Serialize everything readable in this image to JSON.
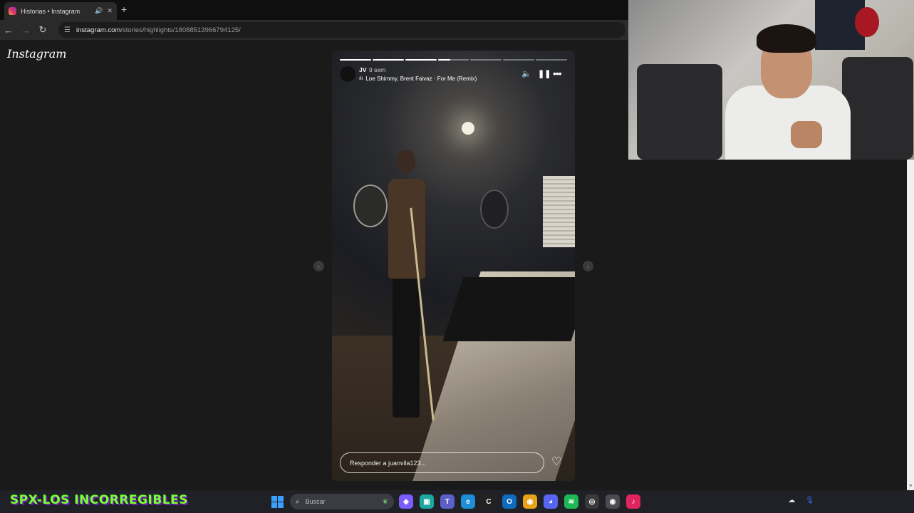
{
  "browser": {
    "tab_title": "Historias • Instagram",
    "tab_audio_icon": "speaker-icon",
    "tab_close": "✕",
    "new_tab": "+",
    "url_domain": "instagram.com",
    "url_path": "/stories/highlights/18088513966794125/"
  },
  "instagram": {
    "logo": "Instagram",
    "story": {
      "username": "JV",
      "time_ago": "9 sem",
      "music_icon": "music-bars-icon",
      "music": "Loe Shimmy, Brent Faivaz · For Me (Remix)",
      "progress": [
        1,
        1,
        1,
        0.4,
        0,
        0,
        0
      ],
      "reply_placeholder": "Responder a juanvila123...",
      "controls": [
        "volume-icon",
        "pause-icon",
        "more-icon"
      ]
    }
  },
  "overlay": {
    "banner": "SPX-LOS INCORREGIBLES"
  },
  "taskbar": {
    "search_placeholder": "Buscar",
    "apps": [
      {
        "name": "copilot-icon",
        "color": "#7a5cff",
        "glyph": "◆"
      },
      {
        "name": "store-icon",
        "color": "#1aa8a0",
        "glyph": "▣"
      },
      {
        "name": "teams-icon",
        "color": "#5b5fc7",
        "glyph": "T"
      },
      {
        "name": "edge-icon",
        "color": "#1e8fd6",
        "glyph": "e"
      },
      {
        "name": "call-of-duty-icon",
        "color": "#222222",
        "glyph": "C"
      },
      {
        "name": "outlook-icon",
        "color": "#0f6cbd",
        "glyph": "O"
      },
      {
        "name": "chrome-icon",
        "color": "#e8a317",
        "glyph": "◉"
      },
      {
        "name": "discord-icon",
        "color": "#5865f2",
        "glyph": "◕"
      },
      {
        "name": "spotify-icon",
        "color": "#1db954",
        "glyph": "≋"
      },
      {
        "name": "obs-icon",
        "color": "#3a3a3a",
        "glyph": "◎"
      },
      {
        "name": "chrome-active-icon",
        "color": "#4a4a4f",
        "glyph": "◉"
      },
      {
        "name": "tiktok-icon",
        "color": "#e0245e",
        "glyph": "♪"
      }
    ]
  }
}
